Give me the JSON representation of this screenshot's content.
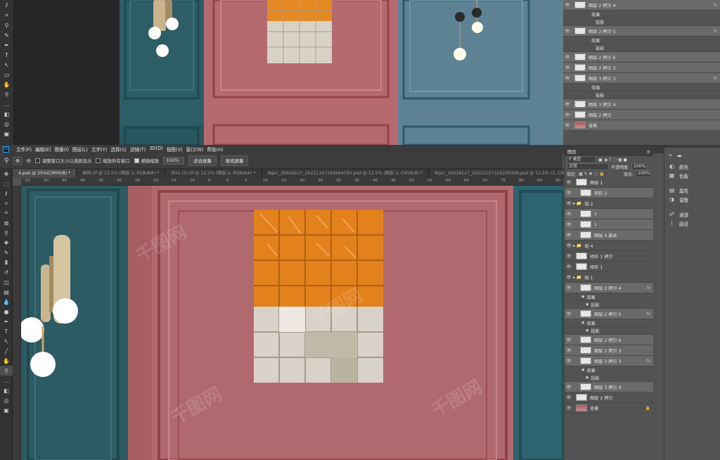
{
  "menu": {
    "app_icon": "Ps",
    "items": [
      "文件(F)",
      "编辑(E)",
      "图像(I)",
      "图层(L)",
      "文字(Y)",
      "选择(S)",
      "滤镜(T)",
      "3D(D)",
      "视图(V)",
      "窗口(W)",
      "帮助(H)"
    ]
  },
  "window_controls": {
    "minimize": "—",
    "maximize": "□",
    "close": "✕"
  },
  "options": {
    "resize_windows": "调整窗口大小以满屏显示",
    "zoom_all": "缩放所有窗口",
    "scrubby_zoom": "细微缩放",
    "zoom_value": "100%",
    "fit_screen": "适合屏幕",
    "fill_screen": "填充屏幕"
  },
  "tabs": [
    "4.psd @ 25%(CMYK/8) *",
    "屏例.tif @ 12.5% (图层 3, RGB/8#) *",
    "ZH1 (2).tif @ 12.5% (图层 6, RGB/8#) *",
    "Nipic_30618227_20221107192644783.psd @ 12.5% (图层 3, CMYK/8) *",
    "Nipic_30618227_20221107220229306.psd @ 12.5% (1, CMYK/8) *"
  ],
  "ruler_ticks": [
    "55",
    "50",
    "45",
    "40",
    "35",
    "30",
    "25",
    "20",
    "15",
    "10",
    "5",
    "0",
    "5",
    "10",
    "15",
    "20",
    "25",
    "30",
    "35",
    "40",
    "45",
    "50",
    "55",
    "60",
    "65",
    "70",
    "75",
    "80",
    "85",
    "90"
  ],
  "layers_panel": {
    "title": "图层",
    "filter": "P 类型",
    "blend_mode": "正常",
    "opacity_label": "不透明度:",
    "opacity_value": "100%",
    "lock_label": "锁定:",
    "fill_label": "填充:",
    "fill_value": "100%",
    "layers": [
      {
        "name": "图层 1",
        "fx": "",
        "kind": "layer",
        "indent": 0
      },
      {
        "name": "矩形 2",
        "fx": "",
        "kind": "layer",
        "indent": 1
      },
      {
        "name": "组 2",
        "fx": "",
        "kind": "group",
        "indent": 0
      },
      {
        "name": "1",
        "fx": "",
        "kind": "layer",
        "indent": 1
      },
      {
        "name": "1",
        "fx": "",
        "kind": "layer",
        "indent": 1
      },
      {
        "name": "图层 4 副本",
        "fx": "",
        "kind": "layer",
        "indent": 1
      },
      {
        "name": "组 4",
        "fx": "",
        "kind": "group",
        "indent": 0
      },
      {
        "name": "矩形 1 拷贝",
        "fx": "",
        "kind": "layer",
        "indent": 0
      },
      {
        "name": "矩形 1",
        "fx": "",
        "kind": "layer",
        "indent": 0
      },
      {
        "name": "组 1",
        "fx": "",
        "kind": "group",
        "indent": 0
      },
      {
        "name": "图层 2 拷贝 4",
        "fx": "fx",
        "kind": "layer",
        "indent": 1
      },
      {
        "name": "效果",
        "fx": "",
        "kind": "effect",
        "indent": 2
      },
      {
        "name": "投影",
        "fx": "",
        "kind": "effect",
        "indent": 3
      },
      {
        "name": "图层 2 拷贝 5",
        "fx": "fx",
        "kind": "layer",
        "indent": 1
      },
      {
        "name": "效果",
        "fx": "",
        "kind": "effect",
        "indent": 2
      },
      {
        "name": "投影",
        "fx": "",
        "kind": "effect",
        "indent": 3
      },
      {
        "name": "图层 2 拷贝 6",
        "fx": "",
        "kind": "layer",
        "indent": 1
      },
      {
        "name": "图层 2 拷贝 3",
        "fx": "",
        "kind": "layer",
        "indent": 1
      },
      {
        "name": "图层 3 拷贝 3",
        "fx": "fx",
        "kind": "layer",
        "indent": 1
      },
      {
        "name": "效果",
        "fx": "",
        "kind": "effect",
        "indent": 2
      },
      {
        "name": "投影",
        "fx": "",
        "kind": "effect",
        "indent": 3
      },
      {
        "name": "图层 3 拷贝 4",
        "fx": "",
        "kind": "layer",
        "indent": 1
      },
      {
        "name": "图层 2 拷贝",
        "fx": "",
        "kind": "layer",
        "indent": 0
      },
      {
        "name": "背景",
        "fx": "",
        "kind": "bg",
        "indent": 0
      }
    ]
  },
  "top_layers": [
    {
      "name": "图层 2 拷贝 4",
      "fx": "fx"
    },
    {
      "name": "效果",
      "fx": ""
    },
    {
      "name": "投影",
      "fx": ""
    },
    {
      "name": "图层 2 拷贝 5",
      "fx": "fx"
    },
    {
      "name": "效果",
      "fx": ""
    },
    {
      "name": "投影",
      "fx": ""
    },
    {
      "name": "图层 2 拷贝 6",
      "fx": ""
    },
    {
      "name": "图层 2 拷贝 3",
      "fx": ""
    },
    {
      "name": "图层 3 拷贝 3",
      "fx": "fx"
    },
    {
      "name": "效果",
      "fx": ""
    },
    {
      "name": "投影",
      "fx": ""
    },
    {
      "name": "图层 3 拷贝 4",
      "fx": ""
    },
    {
      "name": "图层 2 拷贝",
      "fx": ""
    },
    {
      "name": "背景",
      "fx": ""
    }
  ],
  "right_panel": [
    {
      "icon": "color-icon",
      "label": "颜色"
    },
    {
      "icon": "swatches-icon",
      "label": "色板"
    },
    {
      "icon": "properties-icon",
      "label": "属性"
    },
    {
      "icon": "adjustments-icon",
      "label": "调整"
    },
    {
      "icon": "channels-icon",
      "label": "通道"
    },
    {
      "icon": "paths-icon",
      "label": "路径"
    }
  ],
  "watermark": "千图网"
}
